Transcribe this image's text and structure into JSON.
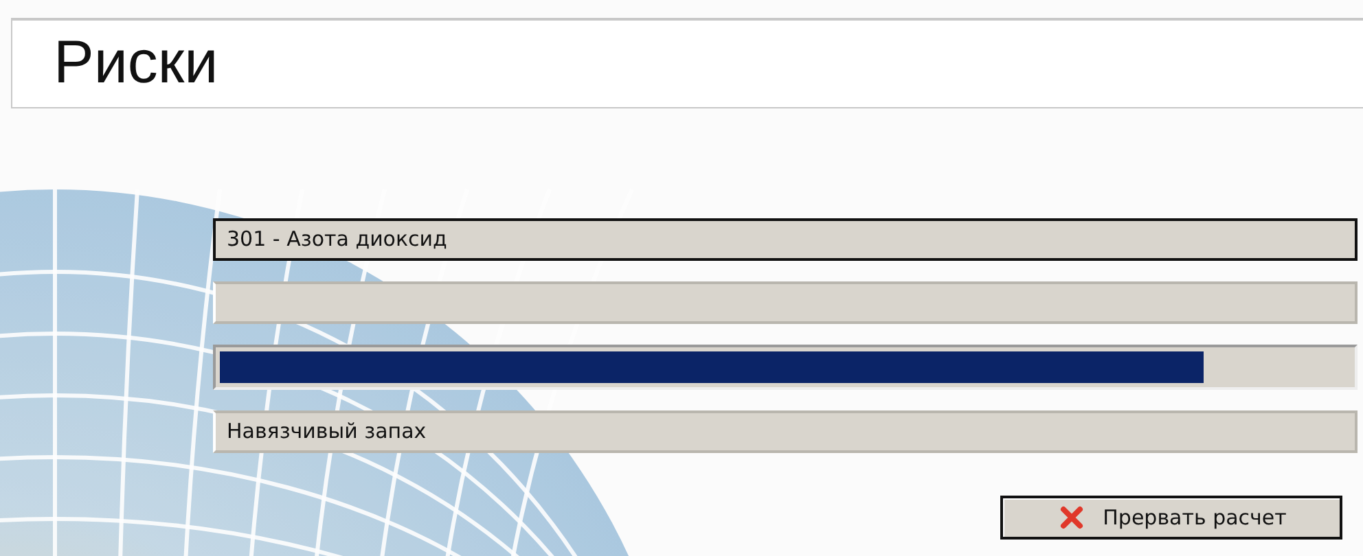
{
  "header": {
    "title": "Риски"
  },
  "fields": [
    {
      "kind": "text",
      "value": "301 - Азота диоксид",
      "focused": true
    },
    {
      "kind": "text",
      "focused": false
    },
    {
      "kind": "progress",
      "level": 0.87
    },
    {
      "kind": "text",
      "value": "Навязчивый запах",
      "focused": false
    }
  ],
  "buttons": [
    {
      "label": "Прервать расчет"
    }
  ]
}
